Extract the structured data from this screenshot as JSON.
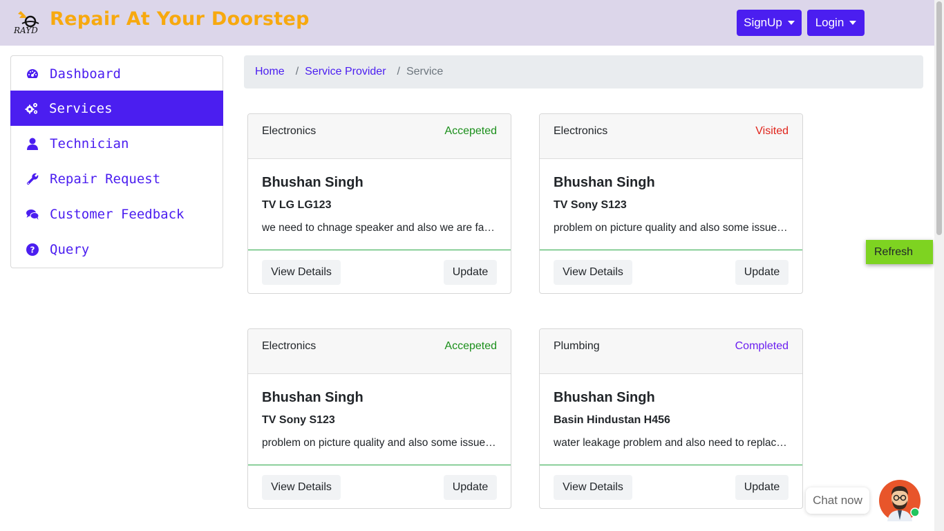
{
  "header": {
    "logo_text": "RAYD",
    "brand": "Repair At Your Doorstep",
    "signup_label": "SignUp",
    "login_label": "Login"
  },
  "sidebar": {
    "items": [
      {
        "label": "Dashboard",
        "icon": "dashboard-gauge-icon"
      },
      {
        "label": "Services",
        "icon": "gears-icon",
        "active": true
      },
      {
        "label": "Technician",
        "icon": "user-icon"
      },
      {
        "label": "Repair Request",
        "icon": "wrench-icon"
      },
      {
        "label": "Customer Feedback",
        "icon": "comments-icon"
      },
      {
        "label": "Query",
        "icon": "question-circle-icon"
      }
    ]
  },
  "breadcrumb": {
    "home": "Home",
    "sep": "/",
    "provider": "Service Provider",
    "current": "Service"
  },
  "colors": {
    "accent": "#4b1ef0",
    "brand": "#f7a90f",
    "status_accepted": "#1a8f1a",
    "status_visited": "#e0231a",
    "status_completed": "#6a1ef0",
    "refresh": "#7ed321"
  },
  "cards": [
    {
      "category": "Electronics",
      "status": "Accepeted",
      "name": "Bhushan Singh",
      "device": "TV LG LG123",
      "description": "we need to chnage speaker and also we are facing issue with remote",
      "view_label": "View Details",
      "update_label": "Update"
    },
    {
      "category": "Electronics",
      "status": "Visited",
      "name": "Bhushan Singh",
      "device": "TV Sony S123",
      "description": "problem on picture quality and also some issue with sound",
      "view_label": "View Details",
      "update_label": "Update"
    },
    {
      "category": "Electronics",
      "status": "Accepeted",
      "name": "Bhushan Singh",
      "device": "TV Sony S123",
      "description": "problem on picture quality and also some issue with sound",
      "view_label": "View Details",
      "update_label": "Update"
    },
    {
      "category": "Plumbing",
      "status": "Completed",
      "name": "Bhushan Singh",
      "device": "Basin Hindustan H456",
      "description": "water leakage problem and also need to replace the tap",
      "view_label": "View Details",
      "update_label": "Update"
    }
  ],
  "refresh_label": "Refresh",
  "chat": {
    "label": "Chat now",
    "avatar_icon": "chat-agent-avatar-icon"
  }
}
